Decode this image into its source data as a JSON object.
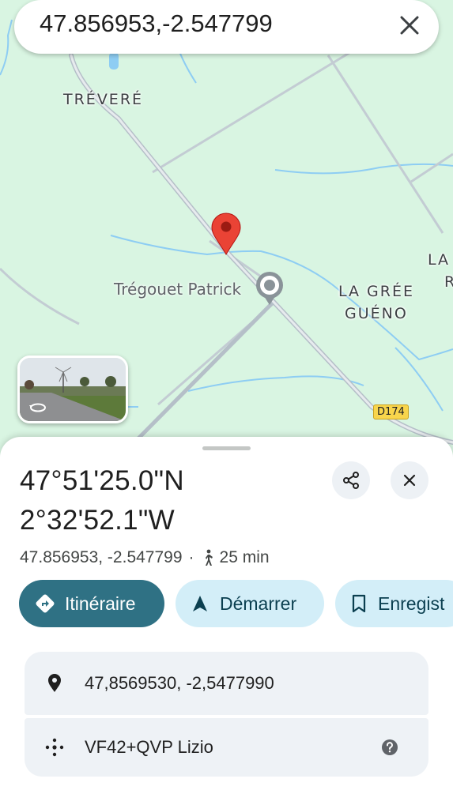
{
  "search": {
    "query": "47.856953,-2.547799"
  },
  "map": {
    "labels": {
      "village": "TRÉVERÉ",
      "grée_line1": "LA GRÉE",
      "grée_line2": "GUÉNO",
      "edge_line1": "LA",
      "edge_line2": "R"
    },
    "poi": "Trégouet Patrick",
    "road_shield": "D174",
    "colors": {
      "land": "#d9f5e2",
      "water": "#8ecdf3",
      "road": "#c3ccd3",
      "pin": "#ea4335"
    }
  },
  "place": {
    "title_line1": "47°51'25.0\"N",
    "title_line2": "2°32'52.1\"W",
    "coords": "47.856953, -2.547799",
    "separator": "·",
    "walk_time": "25 min"
  },
  "actions": {
    "directions": "Itinéraire",
    "start": "Démarrer",
    "save": "Enregist"
  },
  "details": {
    "coordinates": "47,8569530, -2,5477990",
    "plus_code": "VF42+QVP Lizio"
  },
  "icons": [
    "close-icon",
    "share-icon",
    "directions-icon",
    "navigation-arrow-icon",
    "bookmark-icon",
    "location-pin-icon",
    "plus-code-icon",
    "help-icon",
    "walking-icon",
    "rotate-360-icon"
  ]
}
